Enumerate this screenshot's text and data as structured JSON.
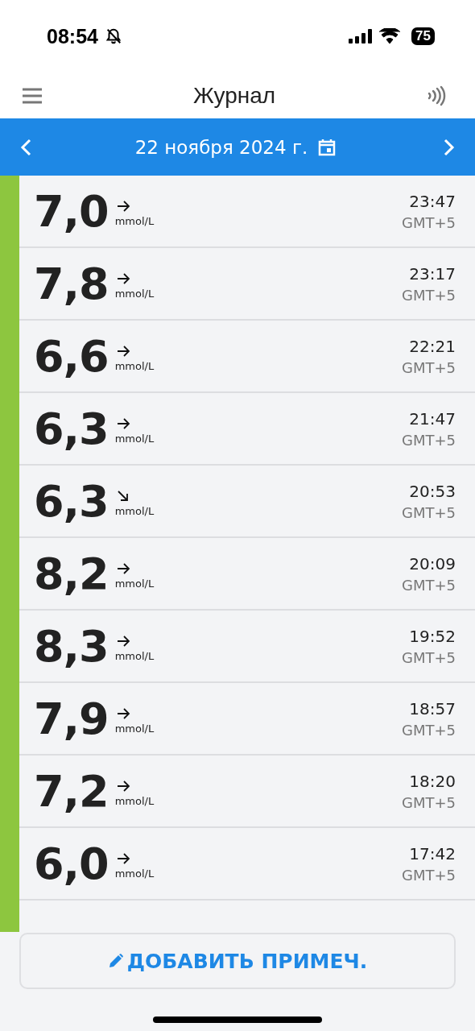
{
  "status_bar": {
    "time": "08:54",
    "battery": "75"
  },
  "header": {
    "title": "Журнал"
  },
  "date_bar": {
    "date": "22 ноября 2024 г."
  },
  "readings": [
    {
      "value": "7,0",
      "unit": "mmol/L",
      "kind": "steady",
      "time": "23:47",
      "zone": "GMT+5"
    },
    {
      "value": "7,8",
      "unit": "mmol/L",
      "kind": "steady",
      "time": "23:17",
      "zone": "GMT+5"
    },
    {
      "value": "6,6",
      "unit": "mmol/L",
      "kind": "steady",
      "time": "22:21",
      "zone": "GMT+5"
    },
    {
      "value": "6,3",
      "unit": "mmol/L",
      "kind": "steady",
      "time": "21:47",
      "zone": "GMT+5"
    },
    {
      "value": "6,3",
      "unit": "mmol/L",
      "kind": "falling",
      "time": "20:53",
      "zone": "GMT+5"
    },
    {
      "value": "8,2",
      "unit": "mmol/L",
      "kind": "steady",
      "time": "20:09",
      "zone": "GMT+5"
    },
    {
      "value": "8,3",
      "unit": "mmol/L",
      "kind": "steady",
      "time": "19:52",
      "zone": "GMT+5"
    },
    {
      "value": "7,9",
      "unit": "mmol/L",
      "kind": "steady",
      "time": "18:57",
      "zone": "GMT+5"
    },
    {
      "value": "7,2",
      "unit": "mmol/L",
      "kind": "steady",
      "time": "18:20",
      "zone": "GMT+5"
    },
    {
      "value": "6,0",
      "unit": "mmol/L",
      "kind": "steady",
      "time": "17:42",
      "zone": "GMT+5"
    }
  ],
  "add_note_button": {
    "label": "ДОБАВИТЬ ПРИМЕЧ."
  }
}
